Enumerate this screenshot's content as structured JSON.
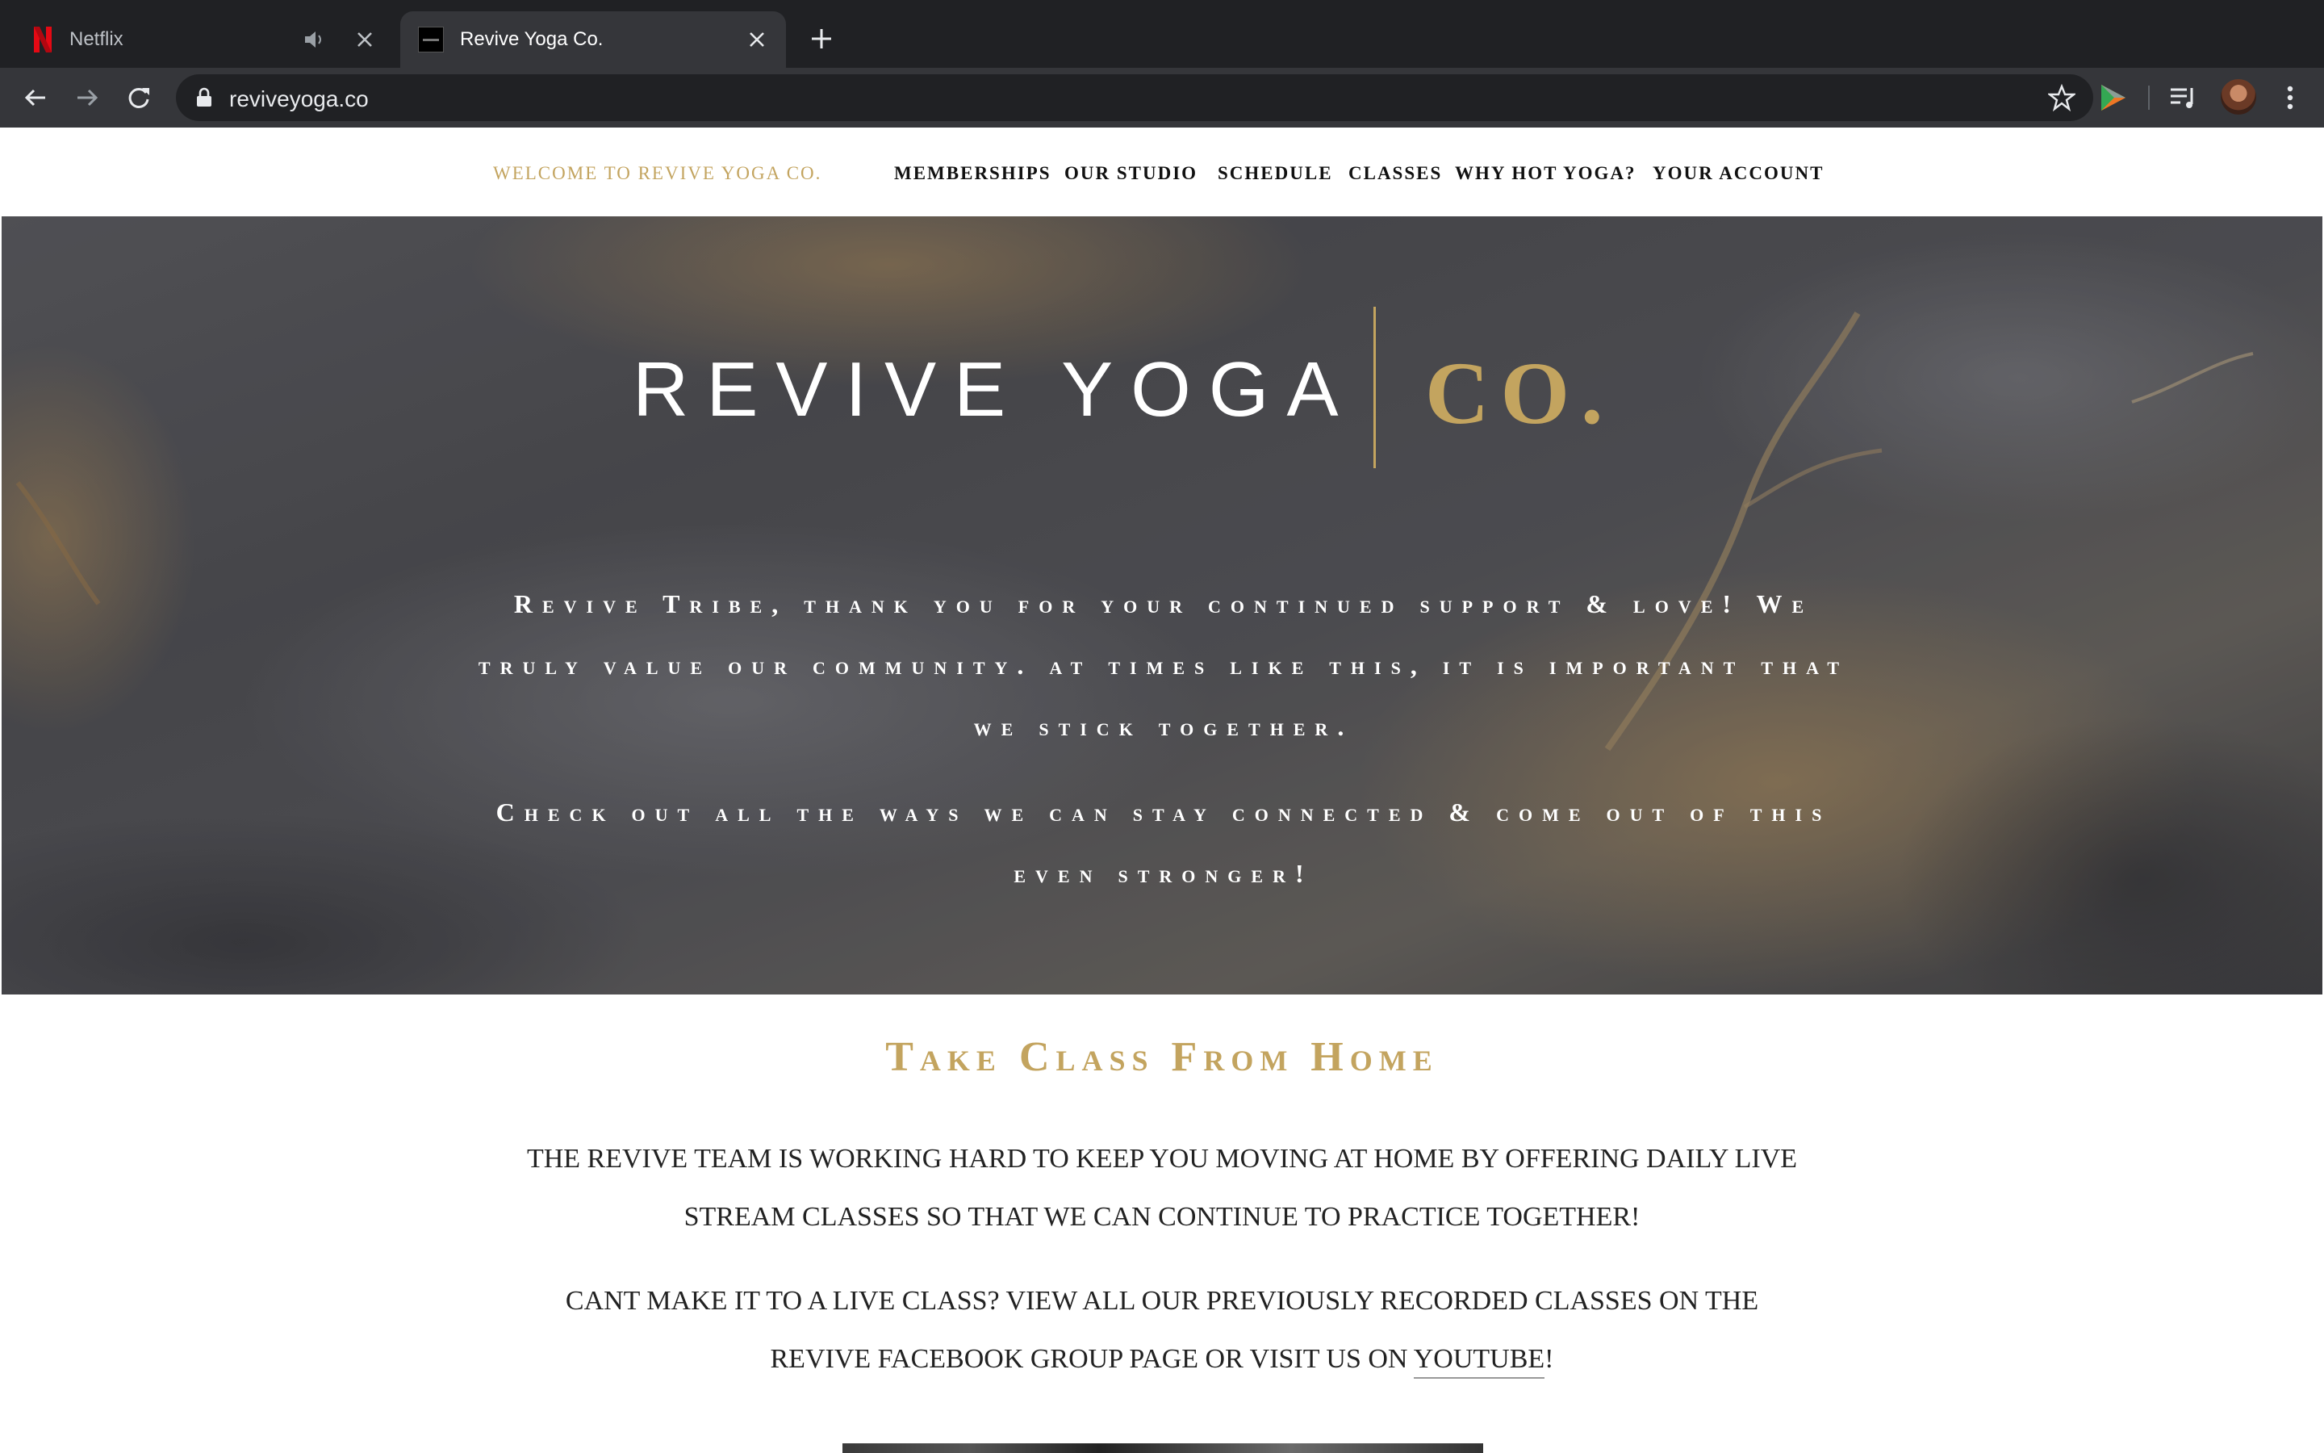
{
  "browser": {
    "tabs": [
      {
        "title": "Netflix",
        "favicon": "netflix-icon",
        "audio": true,
        "active": false
      },
      {
        "title": "Revive Yoga Co.",
        "favicon": "site-icon",
        "active": true
      }
    ],
    "url": "reviveyoga.co"
  },
  "nav": {
    "welcome": "WELCOME TO REVIVE YOGA CO.",
    "items": [
      "MEMBERSHIPS",
      "OUR STUDIO",
      "SCHEDULE",
      "CLASSES",
      "WHY HOT YOGA?",
      "YOUR ACCOUNT"
    ]
  },
  "hero": {
    "logo_main": "REVIVE YOGA",
    "logo_accent": "CO.",
    "message1": "Revive Tribe, thank you for your continued support & love! We truly value our community. at times like this, it is important that we stick together.",
    "message2": "Check out all the ways we can stay connected & come out of this even stronger!"
  },
  "content": {
    "title": "Take Class From Home",
    "para1": "THE REVIVE TEAM IS WORKING HARD TO KEEP YOU MOVING AT HOME BY OFFERING DAILY LIVE STREAM CLASSES SO THAT WE CAN CONTINUE TO PRACTICE TOGETHER!",
    "para2_text": "CANT MAKE IT TO A LIVE CLASS? VIEW ALL OUR PREVIOUSLY RECORDED CLASSES ON THE REVIVE FACEBOOK GROUP PAGE OR VISIT US ON ",
    "para2_link": "YOUTUBE",
    "para2_end": "!"
  },
  "colors": {
    "gold": "#c3a45f",
    "chrome_dark": "#202124",
    "chrome_toolbar": "#35363a"
  }
}
